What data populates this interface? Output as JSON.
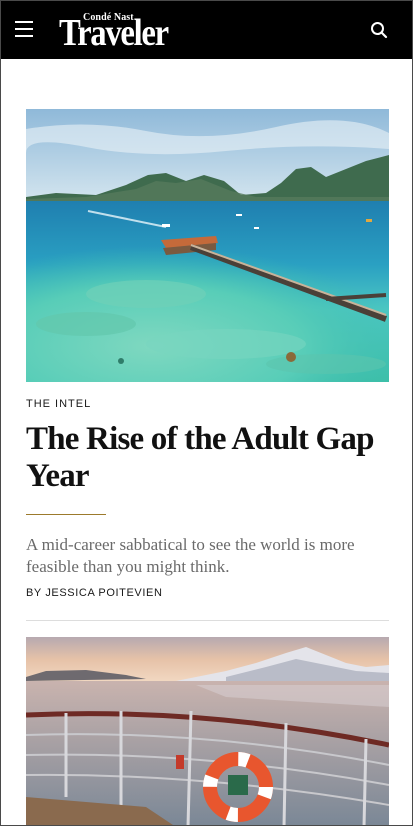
{
  "header": {
    "publisher": "Condé Nast",
    "logo": "Traveler",
    "menu_icon": "hamburger-menu-icon",
    "search_icon": "search-icon",
    "background": "#000000"
  },
  "article": {
    "rubric": "THE INTEL",
    "title": "The Rise of the Adult Gap Year",
    "dek": "A mid-career sabbatical to see the world is more feasible than you might think.",
    "byline": "BY JESSICA POITEVIEN",
    "rule_color": "#9c7a2c"
  },
  "colors": {
    "accent_gold": "#9c7a2c",
    "dek_gray": "#6a6a6a"
  }
}
